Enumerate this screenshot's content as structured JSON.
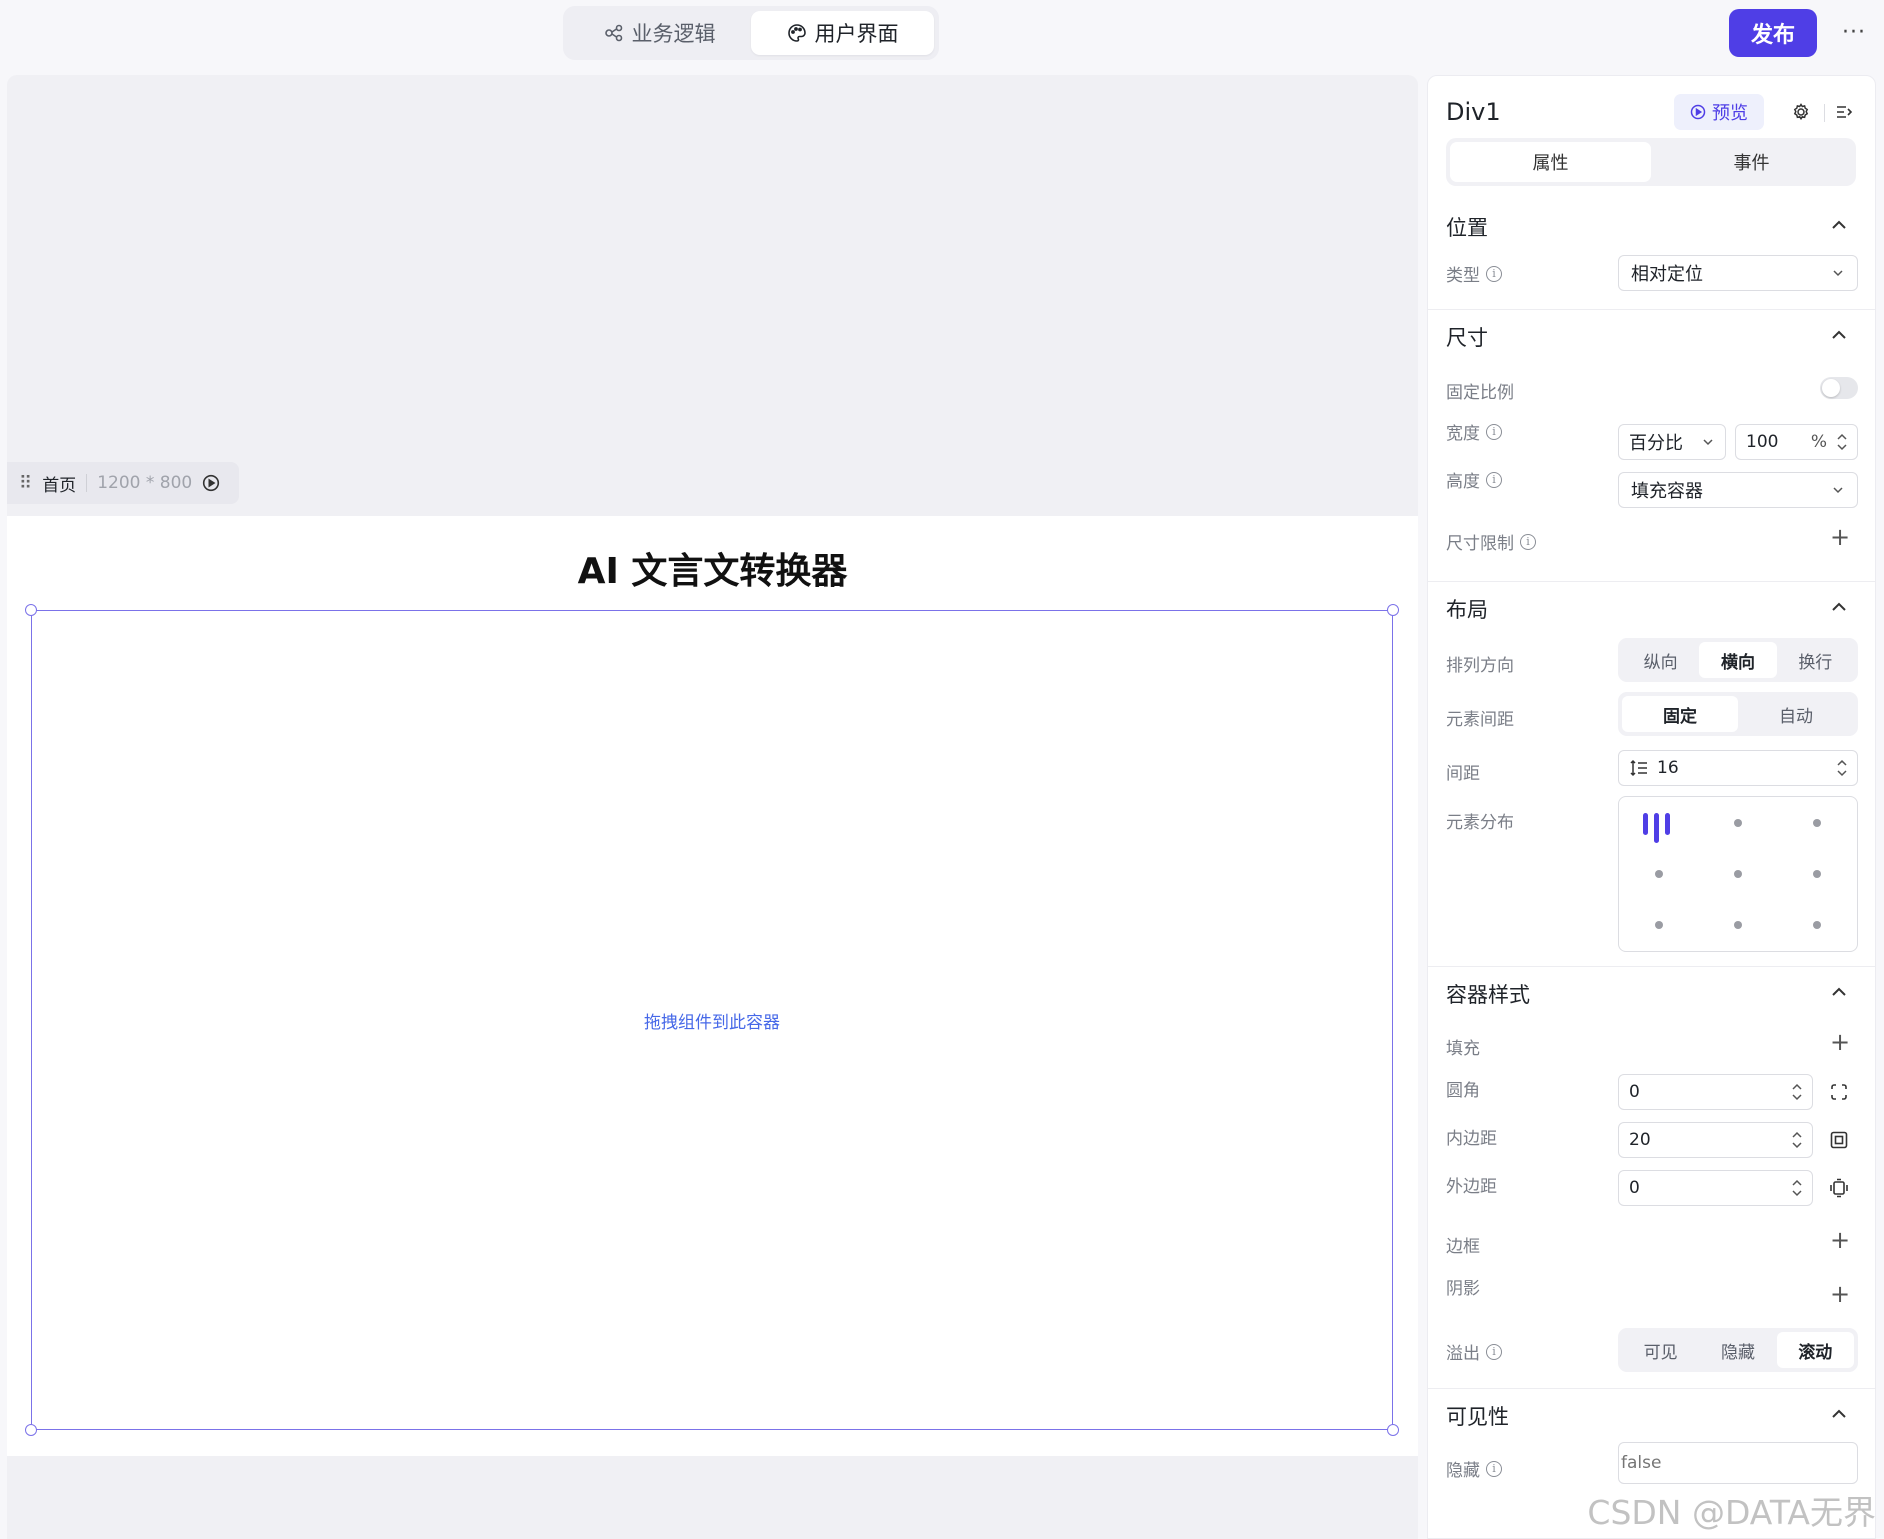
{
  "top": {
    "tabs": [
      {
        "label": "业务逻辑",
        "icon": "flow-icon"
      },
      {
        "label": "用户界面",
        "icon": "palette-icon"
      }
    ],
    "publish_label": "发布",
    "more_label": "···"
  },
  "canvas": {
    "page_name": "首页",
    "page_size": "1200 * 800",
    "title": "AI 文言文转换器",
    "drop_hint": "拖拽组件到此容器"
  },
  "panel": {
    "component_name": "Div1",
    "preview_label": "预览",
    "tabs": [
      "属性",
      "事件"
    ],
    "position": {
      "title": "位置",
      "type_label": "类型",
      "type_value": "相对定位"
    },
    "size": {
      "title": "尺寸",
      "fixed_ratio_label": "固定比例",
      "width_label": "宽度",
      "width_mode": "百分比",
      "width_value": "100",
      "width_unit": "%",
      "height_label": "高度",
      "height_mode": "填充容器",
      "limit_label": "尺寸限制"
    },
    "layout": {
      "title": "布局",
      "direction_label": "排列方向",
      "direction_options": [
        "纵向",
        "横向",
        "换行"
      ],
      "gap_mode_label": "元素间距",
      "gap_mode_options": [
        "固定",
        "自动"
      ],
      "gap_label": "间距",
      "gap_value": "16",
      "distribution_label": "元素分布"
    },
    "container_style": {
      "title": "容器样式",
      "fill_label": "填充",
      "radius_label": "圆角",
      "radius_value": "0",
      "padding_label": "内边距",
      "padding_value": "20",
      "margin_label": "外边距",
      "margin_value": "0",
      "border_label": "边框",
      "shadow_label": "阴影",
      "overflow_label": "溢出",
      "overflow_options": [
        "可见",
        "隐藏",
        "滚动"
      ]
    },
    "visibility": {
      "title": "可见性",
      "hidden_label": "隐藏",
      "hidden_placeholder": "false"
    }
  },
  "watermark": "CSDN @DATA无界",
  "colors": {
    "accent": "#4f3ee6",
    "selection": "#7b72e9",
    "hint": "#4668e8"
  }
}
